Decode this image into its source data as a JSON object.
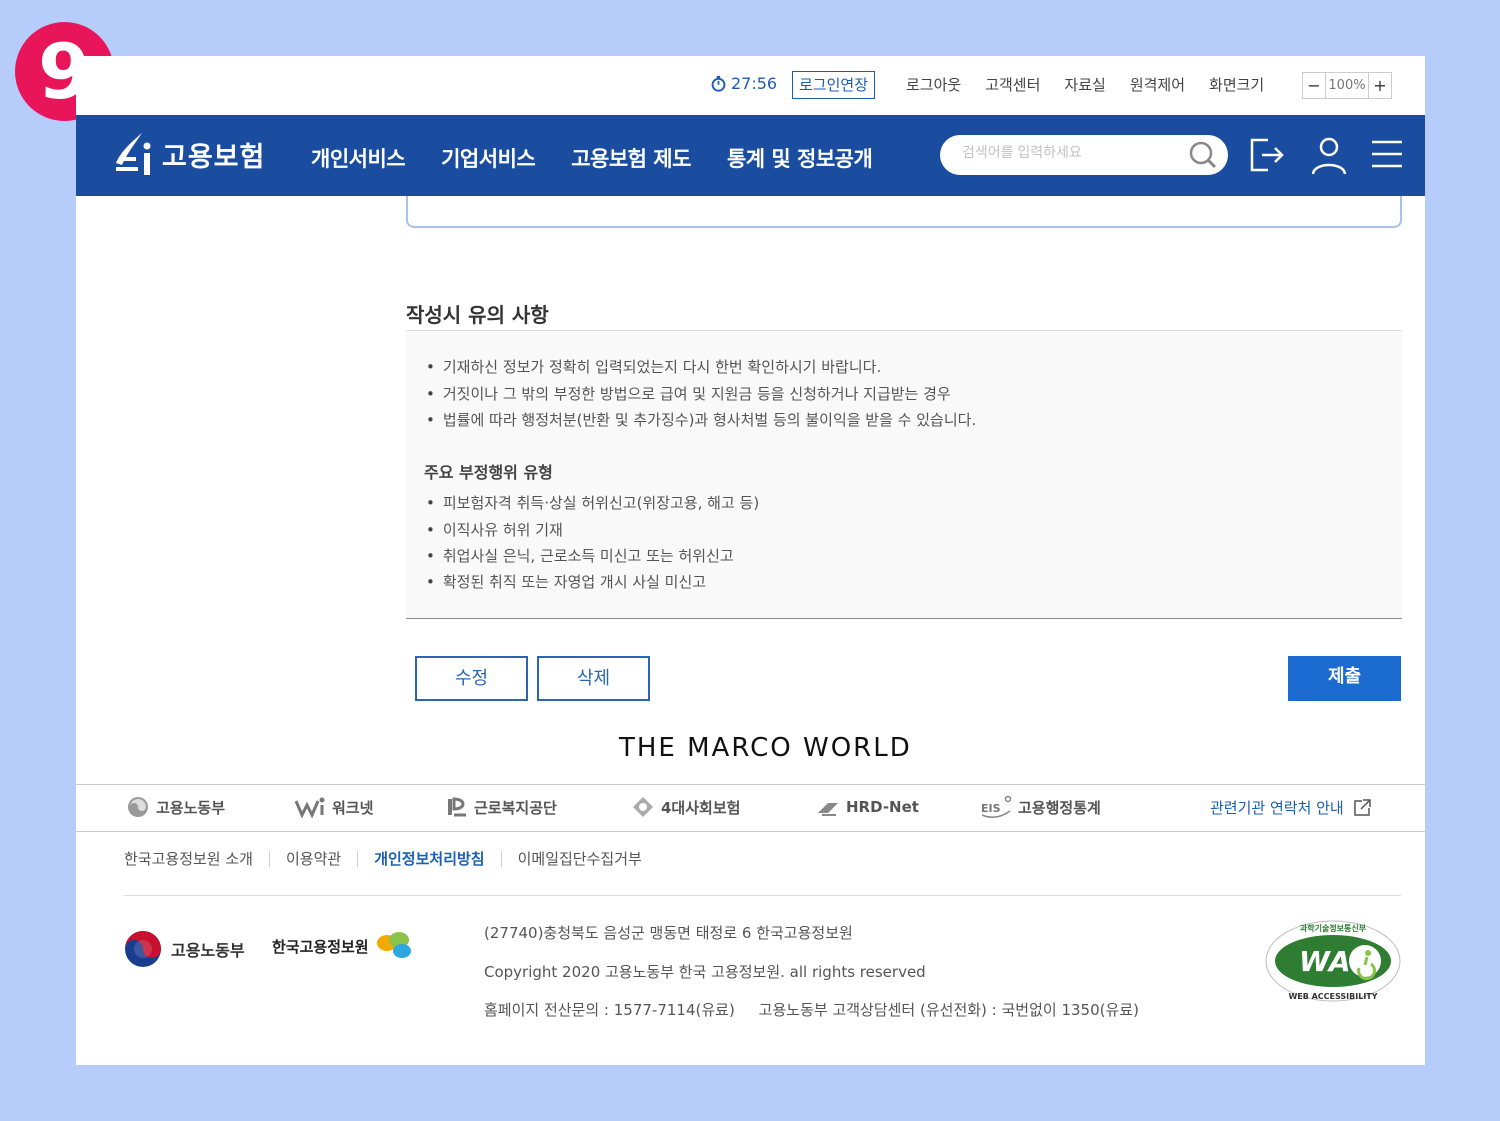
{
  "badge": "9",
  "util": {
    "timer": "27:56",
    "extend_label": "로그인연장",
    "links": [
      "로그아웃",
      "고객센터",
      "자료실",
      "원격제어",
      "화면크기"
    ],
    "zoom_minus": "−",
    "zoom_value": "100%",
    "zoom_plus": "+"
  },
  "nav": {
    "logo_text": "고용보험",
    "menu": [
      "개인서비스",
      "기업서비스",
      "고용보험 제도",
      "통계 및 정보공개"
    ],
    "search_placeholder": "검색어를 입력하세요"
  },
  "notice": {
    "title": "작성시 유의 사항",
    "bullets": [
      "기재하신 정보가 정확히 입력되었는지 다시 한번 확인하시기 바랍니다.",
      "거짓이나 그 밖의 부정한 방법으로 급여 및 지원금 등을 신청하거나 지급받는 경우",
      "법률에 따라 행정처분(반환 및 추가징수)과 형사처벌 등의 불이익을 받을 수 있습니다."
    ],
    "subheading": "주요 부정행위 유형",
    "fraud_types": [
      "피보험자격 취득·상실 허위신고(위장고용, 해고 등)",
      "이직사유 허위 기재",
      "취업사실 은닉, 근로소득 미신고 또는 허위신고",
      "확정된 취직 또는 자영업 개시 사실 미신고"
    ]
  },
  "buttons": {
    "edit": "수정",
    "delete": "삭제",
    "submit": "제출"
  },
  "watermark": "THE MARCO WORLD",
  "footer": {
    "sites": [
      "고용노동부",
      "워크넷",
      "근로복지공단",
      "4대사회보험",
      "HRD-Net",
      "고용행정통계"
    ],
    "related": "관련기관 연락처 안내",
    "links": [
      "한국고용정보원 소개",
      "이용약관",
      "개인정보처리방침",
      "이메일집단수집거부"
    ],
    "org1": "고용노동부",
    "org2": "한국고용정보원",
    "address": "(27740)충청북도 음성군 맹동면 태정로 6 한국고용정보원",
    "copyright": "Copyright 2020 고용노동부 한국 고용정보원. all rights reserved",
    "contact": "홈페이지 전산문의 : 1577-7114(유료)     고용노동부 고객상담센터 (유선전화) : 국번없이 1350(유료)",
    "wa_label": "WA",
    "wa_top": "과학기술정보통신부",
    "wa_bottom": "WEB ACCESSIBILITY"
  },
  "colors": {
    "nav": "#1a4ca0",
    "accent": "#1a6ad0",
    "badge": "#e8155a",
    "background": "#b6cdfb"
  }
}
